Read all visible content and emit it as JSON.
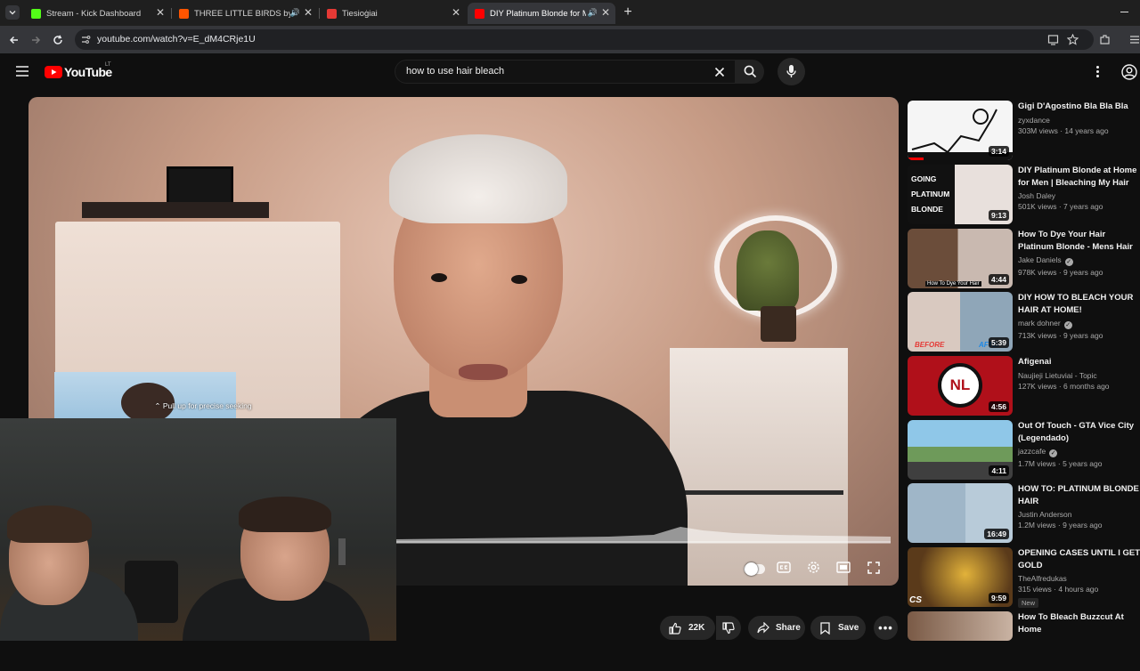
{
  "browser": {
    "tabs": [
      {
        "title": "Stream - Kick Dashboard",
        "favicon_color": "#53fc18"
      },
      {
        "title": "THREE LITTLE BIRDS by Bob",
        "favicon_color": "#ff5500"
      },
      {
        "title": "Tiesioġiai",
        "favicon_color": "#e53935"
      },
      {
        "title": "DIY Platinum Blonde for Me",
        "favicon_color": "#ff0000"
      }
    ],
    "url": "youtube.com/watch?v=E_dM4CRje1U"
  },
  "youtube": {
    "logo_text": "YouTube",
    "country_code": "LT",
    "search_query": "how to use hair bleach"
  },
  "player": {
    "seek_tooltip": "Pull up for precise seeking"
  },
  "actions": {
    "likes": "22K",
    "share": "Share",
    "save": "Save"
  },
  "recommendations": [
    {
      "title": "Gigi D'Agostino Bla Bla Bla",
      "channel": "zyxdance",
      "meta": "303M views · 14 years ago",
      "duration": "3:14",
      "verified": false
    },
    {
      "title": "DIY Platinum Blonde at Home for Men | Bleaching My Hair fo...",
      "channel": "Josh Daley",
      "meta": "501K views · 7 years ago",
      "duration": "9:13",
      "verified": false
    },
    {
      "title": "How To Dye Your Hair Platinum Blonde - Mens Hair Tutorial ...",
      "channel": "Jake Daniels",
      "meta": "978K views · 9 years ago",
      "duration": "4:44",
      "verified": true
    },
    {
      "title": "DIY HOW TO BLEACH YOUR HAIR AT HOME!",
      "channel": "mark dohner",
      "meta": "713K views · 9 years ago",
      "duration": "5:39",
      "verified": true
    },
    {
      "title": "Afigenai",
      "channel": "Naujieji Lietuviai - Topic",
      "meta": "127K views · 6 months ago",
      "duration": "4:56",
      "verified": false
    },
    {
      "title": "Out Of Touch - GTA Vice City (Legendado)",
      "channel": "jazzcafe",
      "meta": "1.7M views · 5 years ago",
      "duration": "4:11",
      "verified": true
    },
    {
      "title": "HOW TO: PLATINUM BLONDE HAIR",
      "channel": "Justin Anderson",
      "meta": "1.2M views · 9 years ago",
      "duration": "16:49",
      "verified": false
    },
    {
      "title": "OPENING CASES UNTIL I GET GOLD",
      "channel": "TheAlfredukas",
      "meta": "315 views · 4 hours ago",
      "duration": "9:59",
      "verified": false,
      "badge": "New"
    },
    {
      "title": "How To Bleach Buzzcut At Home",
      "channel": "",
      "meta": "",
      "duration": "",
      "verified": false
    }
  ],
  "thumb_text": {
    "going_platinum": [
      "GOING",
      "PLATINUM",
      "BLONDE"
    ],
    "dye_caption": "How To Dye Your Hair",
    "before": "BEFORE",
    "after": "AFTER",
    "nl": "NL",
    "cs": "CS"
  },
  "colors": {
    "youtube_red": "#ff0000",
    "bg": "#0f0f0f",
    "surface": "#272727"
  }
}
